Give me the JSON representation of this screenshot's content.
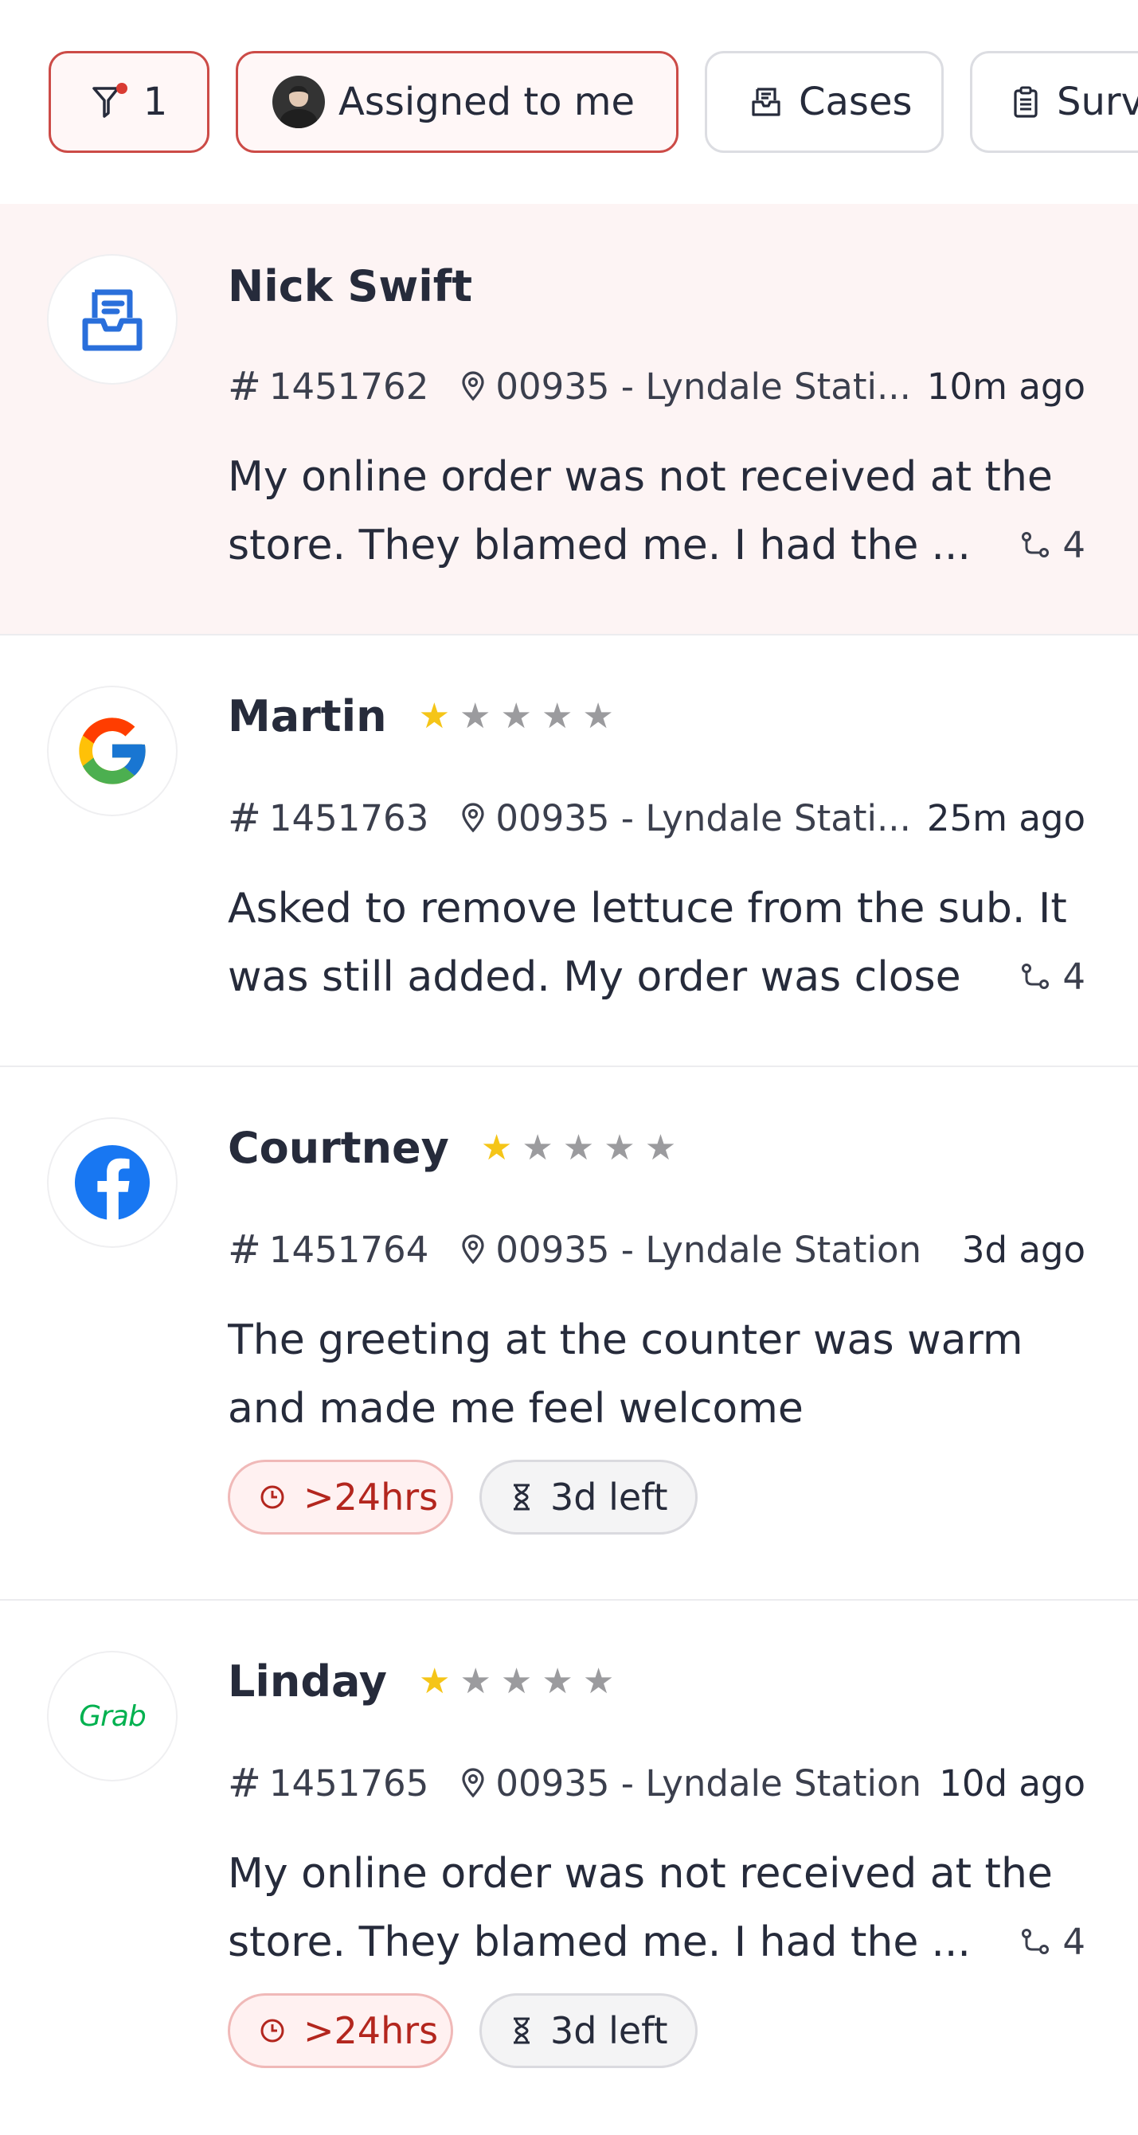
{
  "filters": {
    "filter_count": "1",
    "assigned_label": "Assigned to me",
    "cases_label": "Cases",
    "survey_label": "Surve"
  },
  "tickets": [
    {
      "name": "Nick Swift",
      "source": "case",
      "rating": null,
      "id": "1451762",
      "location": "00935 - Lyndale Stati...",
      "time": "10m ago",
      "message_line1": "My online order was not received at the",
      "message_line2": "store. They blamed me. I had the",
      "truncated": true,
      "replies": "4",
      "tags": []
    },
    {
      "name": "Martin",
      "source": "google",
      "rating": 1,
      "id": "1451763",
      "location": "00935 - Lyndale Stati...",
      "time": "25m ago",
      "message_line1": "Asked to remove lettuce from the sub. It",
      "message_line2": "was still added. My order was close",
      "truncated": false,
      "replies": "4",
      "tags": []
    },
    {
      "name": "Courtney",
      "source": "facebook",
      "rating": 1,
      "id": "1451764",
      "location": "00935 - Lyndale Station",
      "time": "3d ago",
      "message_line1": "The greeting at the counter was warm",
      "message_line2": "and made me feel welcome",
      "truncated": false,
      "replies": null,
      "tags": [
        ">24hrs",
        "3d left"
      ]
    },
    {
      "name": "Linday",
      "source": "grab",
      "rating": 1,
      "id": "1451765",
      "location": "00935 - Lyndale Station",
      "time": "10d ago",
      "message_line1": "My online order was not received at the",
      "message_line2": "store. They blamed me. I had the",
      "truncated": true,
      "replies": "4",
      "tags": [
        ">24hrs",
        "3d left"
      ]
    }
  ],
  "logos": {
    "grab_text": "Grab"
  },
  "colors": {
    "accent_red": "#cc4b47",
    "highlight_bg": "#fdf4f4",
    "star_on": "#f5c518",
    "star_off": "#9b9b9e",
    "facebook_blue": "#1877f2",
    "grab_green": "#00b14f",
    "case_blue": "#2a6fdb"
  },
  "ellipsis": "...",
  "hash_symbol": "#",
  "star_glyph": "★"
}
